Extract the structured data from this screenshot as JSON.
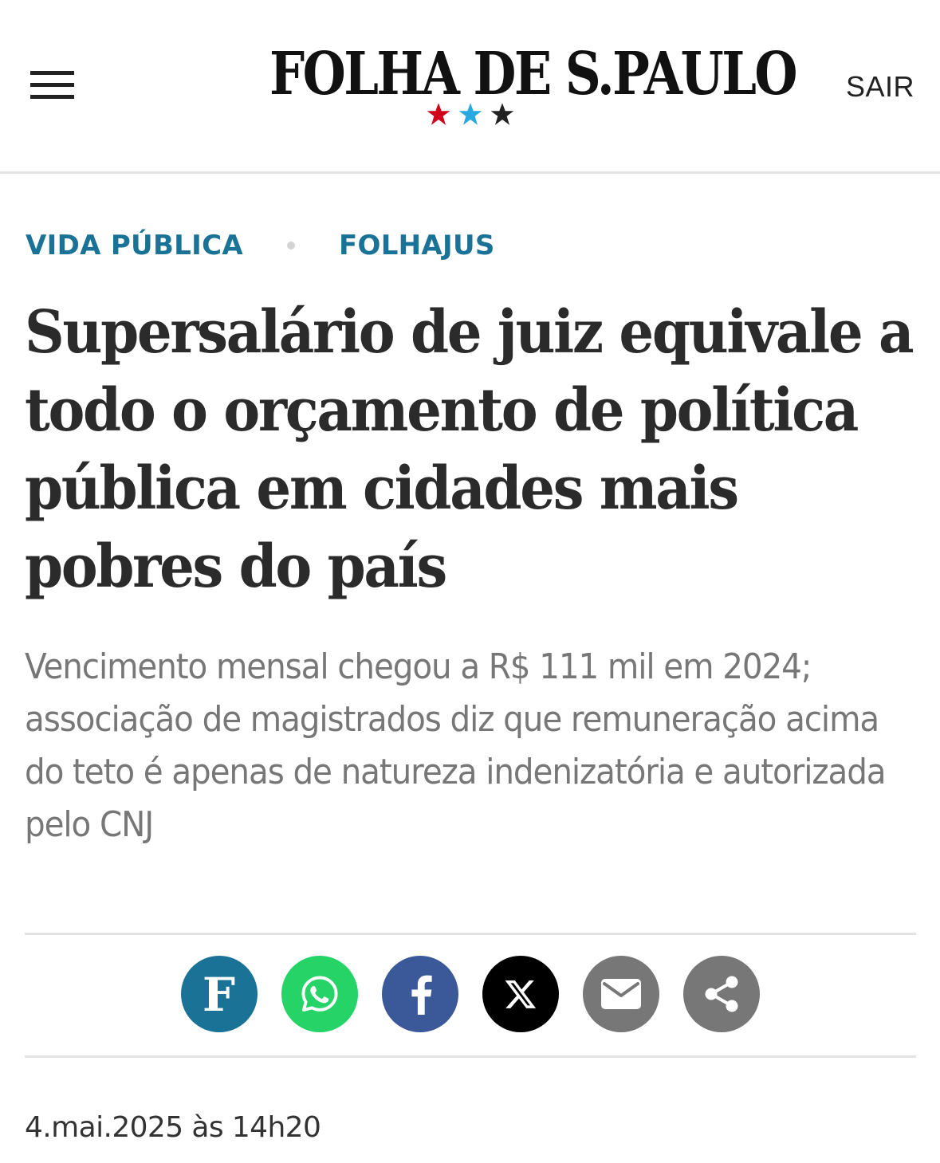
{
  "header": {
    "menu_icon": "hamburger-menu-icon",
    "logo_text": "FOLHA DE S.PAULO",
    "star_colors": [
      "#d0021b",
      "#2aa9e0",
      "#222222"
    ],
    "logout_label": "SAIR"
  },
  "article": {
    "kickers": [
      {
        "label": "VIDA PÚBLICA"
      },
      {
        "label": "FOLHAJUS"
      }
    ],
    "headline": "Supersalário de juiz equivale a todo o orçamento de política pública em cidades mais pobres do país",
    "subtitle": "Vencimento mensal chegou a R$ 111 mil em 2024; associação de magistrados diz que remuneração acima do teto é apenas de natureza indenizatória e autorizada pelo CNJ",
    "date": "4.mai.2025 às 14h20"
  },
  "share": {
    "buttons": [
      {
        "name": "folha-share-button",
        "icon": "folha-f-icon",
        "color": "#1a7396",
        "glyph": "F"
      },
      {
        "name": "whatsapp-share-button",
        "icon": "whatsapp-icon",
        "color": "#25d366"
      },
      {
        "name": "facebook-share-button",
        "icon": "facebook-icon",
        "color": "#3b5998"
      },
      {
        "name": "x-share-button",
        "icon": "x-icon",
        "color": "#000000"
      },
      {
        "name": "email-share-button",
        "icon": "mail-icon",
        "color": "#777777"
      },
      {
        "name": "more-share-button",
        "icon": "share-icon",
        "color": "#777777"
      }
    ]
  },
  "colors": {
    "kicker": "#1a7396",
    "headline": "#2b2b2b",
    "subtitle": "#777777",
    "divider": "#e3e3e3"
  }
}
